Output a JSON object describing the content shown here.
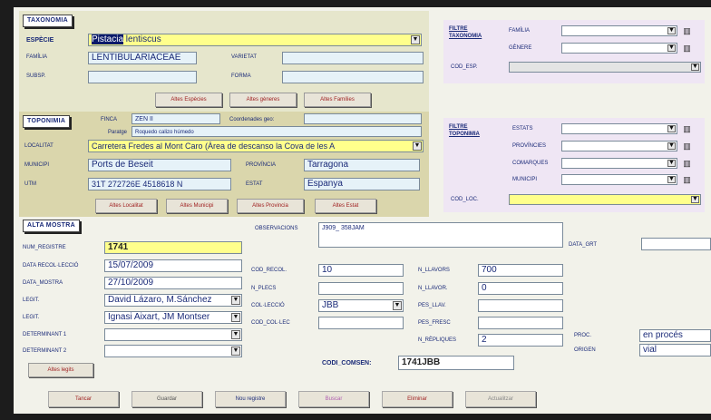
{
  "taxonomia": {
    "section": "TAXONOMIA",
    "especie_label": "ESPÈCIE",
    "especie_selected": "Pistacia",
    "especie_rest": " lentiscus",
    "familia_label": "FAMÍLIA",
    "familia": "LENTIBULARIACEAE",
    "varietat_label": "VARIETAT",
    "subsp_label": "SUBSP.",
    "forma_label": "FORMA",
    "buttons": [
      "Altes Espècies",
      "Altes gèneres",
      "Altes Famílies"
    ]
  },
  "filtre_taxonomia": {
    "title": "FILTRE TAXONOMIA",
    "familia_label": "FAMÍLIA",
    "genere_label": "GÈNERE",
    "cod_esp_label": "COD_ESP."
  },
  "toponimia": {
    "section": "TOPONIMIA",
    "finca_label": "FINCA",
    "finca": "ZEN II",
    "coordenades_label": "Coordenades geo:",
    "paratge_label": "Paratge",
    "paratge": "Roquedo calizo húmedo",
    "localitat_label": "LOCALITAT",
    "localitat": "Carretera Fredes al Mont Caro (Àrea de descanso la Cova de les A",
    "municipi_label": "MUNICIPI",
    "municipi": "Ports de Beseit",
    "provincia_label": "PROVÍNCIA",
    "provincia": "Tarragona",
    "utm_label": "UTM",
    "utm": "31T 272726E 4518618 N",
    "estat_label": "ESTAT",
    "estat": "Espanya",
    "buttons": [
      "Altes Localitat",
      "Altes Municipi",
      "Altes Provincia",
      "Altes Estat"
    ]
  },
  "filtre_toponimia": {
    "title": "FILTRE TOPONIMIA",
    "estats_label": "ESTATS",
    "provincies_label": "PROVÍNCIES",
    "comarques_label": "COMARQUES",
    "municipi_label": "MUNICIPI",
    "cod_loc_label": "COD_LOC."
  },
  "alta_mostra": {
    "section": "ALTA MOSTRA",
    "registre_label": "NUM_REGISTRE",
    "registre": "1741",
    "data_recollecio_label": "DATA RECOL·LECCIÓ",
    "data_recollecio": "15/07/2009",
    "data_mostra_label": "DATA_MOSTRA",
    "data_mostra": "27/10/2009",
    "leg_label": "LEGIT.",
    "leg": "David Lázaro, M.Sánchez",
    "det_label": "LEGIT.",
    "det": "Ignasi Aixart, JM Montser",
    "determinant1_label": "DETERMINANT 1",
    "determinant2_label": "DETERMINANT 2",
    "altes_button": "Altes legits",
    "observacions_label": "OBSERVACIONS",
    "observacions": "J909_ 358JAM",
    "cod_recol_label": "COD_RECOL.",
    "cod_recol": "10",
    "n_plecs_label": "N_PLECS",
    "collecio_label": "COL·LECCIÓ",
    "collecio": "JBB",
    "cod_collec_label": "COD_COL·LEC",
    "n_llavors_label": "N_LLAVORS",
    "n_llavors": "700",
    "n_llavors2_label": "N_LLAVOR.",
    "n_llavors2": "0",
    "pes_llav_label": "PES_LLAV.",
    "pes_fresc_label": "PES_FRESC",
    "n_replicas_label": "N_RÈPLIQUES",
    "n_replicas": "2",
    "data_germ_label": "DATA_GRT",
    "proc_label": "PROC.",
    "proc": "en procés",
    "origen_label": "ORIGEN",
    "origen": "vial",
    "cod_comsen_label": "CODI_COMSEN:",
    "cod_comsen": "1741JBB"
  },
  "bottom_buttons": [
    "Tancar",
    "Guardar",
    "Nou registre",
    "Buscar",
    "Eliminar",
    "Actualitzar"
  ],
  "colors": {
    "panel_taxonomia": "#e6e6cc",
    "panel_toponimia": "#dad6ac",
    "filter_panel": "#efe6f4",
    "label_blue": "#1a2a78",
    "highlight_yellow": "#ffff8c",
    "input_blue": "#e6f2f8",
    "selection_navy": "#0a1a6a"
  },
  "icons": [
    "dropdown-arrow-icon",
    "trash-icon"
  ]
}
